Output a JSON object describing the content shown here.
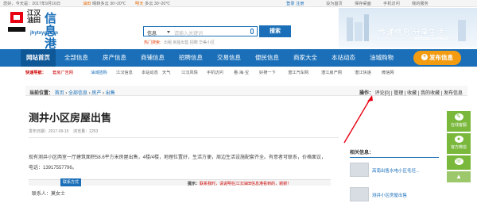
{
  "topbar": {
    "greeting": "您好，今天是：2017年9月16日",
    "weather1_city": "油田",
    "weather1": "晴转多云 30~20℃",
    "weather2_city": "明天",
    "weather2": "多云 30~20℃",
    "login": "登录",
    "register": "注册",
    "links": [
      "设为首页",
      "保存桌面",
      "手机访问",
      "我的服务"
    ]
  },
  "brand": {
    "line1": "江汉",
    "line2": "油田",
    "big": "信息港",
    "url": "jhytxyg.com",
    "logo_text": "ilnoec"
  },
  "search": {
    "category": "信息",
    "placeholder": "请输入关键词",
    "button": "搜索",
    "hot_label": "热门搜索：",
    "hot_words": "出租  房屋出售  招聘  华美小区"
  },
  "banner": {
    "slogan": "传递信息 分享生活",
    "sub": "Welcome to oilfield"
  },
  "nav": {
    "items": [
      "网站首页",
      "全部信息",
      "房产信息",
      "商铺信息",
      "招聘信息",
      "交易信息",
      "便民信息",
      "商家大全",
      "本站动态",
      "油城购物"
    ],
    "publish": "发布信息"
  },
  "quick": {
    "label": "快速导航：",
    "items": [
      "套房广告网",
      "油城团购",
      "江汉信息",
      "本站动态",
      "天气",
      "江汉风情",
      "手机访问",
      "看·海·宝",
      "好搜一下",
      "潜江汽车网",
      "潜江房产网",
      "潜江快递",
      "微信网"
    ]
  },
  "breadcrumb": {
    "label": "当前位置：",
    "path": [
      "首页",
      "全部信息",
      "房产",
      "出售"
    ],
    "ops_label": "操作：",
    "ops": [
      "评论[0]",
      "管理",
      "收藏",
      "我的收藏",
      "发布信息"
    ]
  },
  "article": {
    "title": "测井小区房屋出售",
    "date_label": "发布日期：",
    "date": "2017-09-15",
    "views_label": "浏览量：",
    "views": "2253",
    "description": "现有测井小区两室一厅建筑面积58.6平方米房屋出售，4楼/4楼，地理位置好，生活方便，周边生活设施配套齐全。有意者可联系，价格面议，电话：13917557796。",
    "contact_tab": "联系方式",
    "tip_label": "提示：",
    "tip": "联系我时，请说明在江汉油田信息港看到的，谢谢！",
    "contact_label": "联系人：",
    "contact_name": "莫女士"
  },
  "related": {
    "heading": "相关信息：",
    "items": [
      "高南出售水电小区毛坯...",
      "测井小区房屋出售"
    ]
  },
  "float": {
    "items": [
      "在线客服",
      "官方微信"
    ],
    "top": "▲"
  },
  "colors": {
    "primary": "#1a6fb8",
    "publish": "#f39c12",
    "float": "#7ab83c"
  }
}
